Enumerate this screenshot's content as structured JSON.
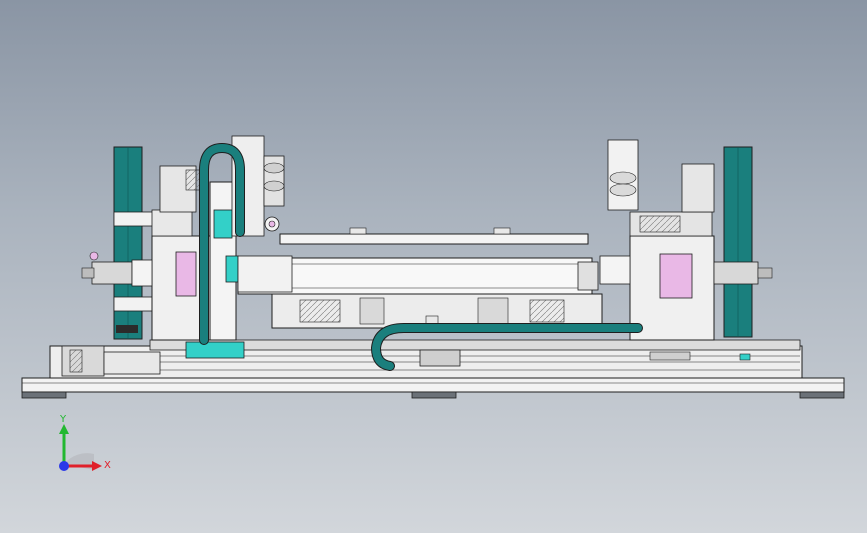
{
  "viewport": {
    "background_top": "#8a95a4",
    "background_bottom": "#d2d6db"
  },
  "colors": {
    "teal": "#1a7f7d",
    "cyan": "#33d0c8",
    "pink": "#e9b8e6",
    "outline": "#1e1e1e",
    "metal": "#f2f2f2",
    "shadow": "#555c63"
  },
  "triad": {
    "x_label": "X",
    "y_label": "Y",
    "x_color": "#e0202a",
    "y_color": "#22b830",
    "z_color": "#2a38e8"
  }
}
